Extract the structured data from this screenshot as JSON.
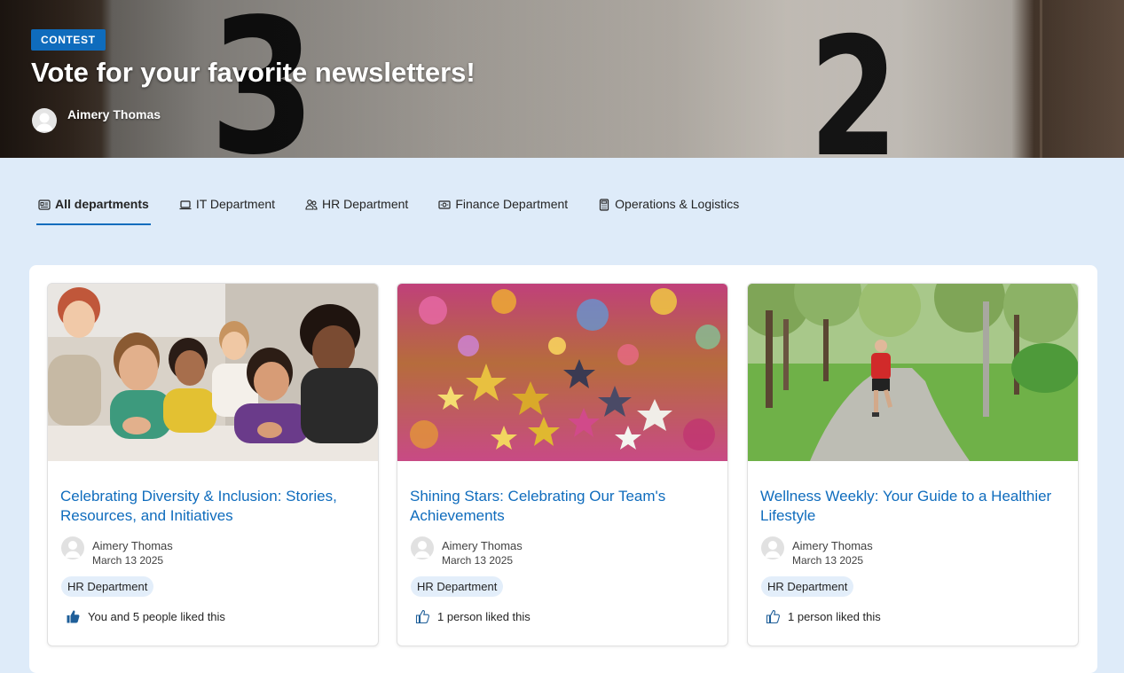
{
  "hero": {
    "badge": "CONTEST",
    "title": "Vote for your favorite newsletters!",
    "author": "Aimery Thomas",
    "image_digits": [
      "3",
      "2"
    ]
  },
  "tabs": [
    {
      "label": "All departments",
      "icon": "news-icon",
      "active": true
    },
    {
      "label": "IT Department",
      "icon": "laptop-icon",
      "active": false
    },
    {
      "label": "HR Department",
      "icon": "people-icon",
      "active": false
    },
    {
      "label": "Finance Department",
      "icon": "money-icon",
      "active": false
    },
    {
      "label": "Operations & Logistics",
      "icon": "calculator-icon",
      "active": false
    }
  ],
  "cards": [
    {
      "title": "Celebrating Diversity & Inclusion: Stories, Resources, and Initiatives",
      "author": "Aimery Thomas",
      "date": "March 13 2025",
      "tag": "HR Department",
      "likes_text": "You and 5 people liked this",
      "liked": true,
      "image": "group-photo"
    },
    {
      "title": "Shining Stars: Celebrating Our Team's Achievements",
      "author": "Aimery Thomas",
      "date": "March 13 2025",
      "tag": "HR Department",
      "likes_text": "1 person liked this",
      "liked": false,
      "image": "star-confetti"
    },
    {
      "title": "Wellness Weekly: Your Guide to a Healthier Lifestyle",
      "author": "Aimery Thomas",
      "date": "March 13 2025",
      "tag": "HR Department",
      "likes_text": "1 person liked this",
      "liked": false,
      "image": "park-jogger"
    }
  ],
  "colors": {
    "accent": "#0f6cbd",
    "page_background": "#deebf9",
    "chip_background": "#e3eefa"
  }
}
